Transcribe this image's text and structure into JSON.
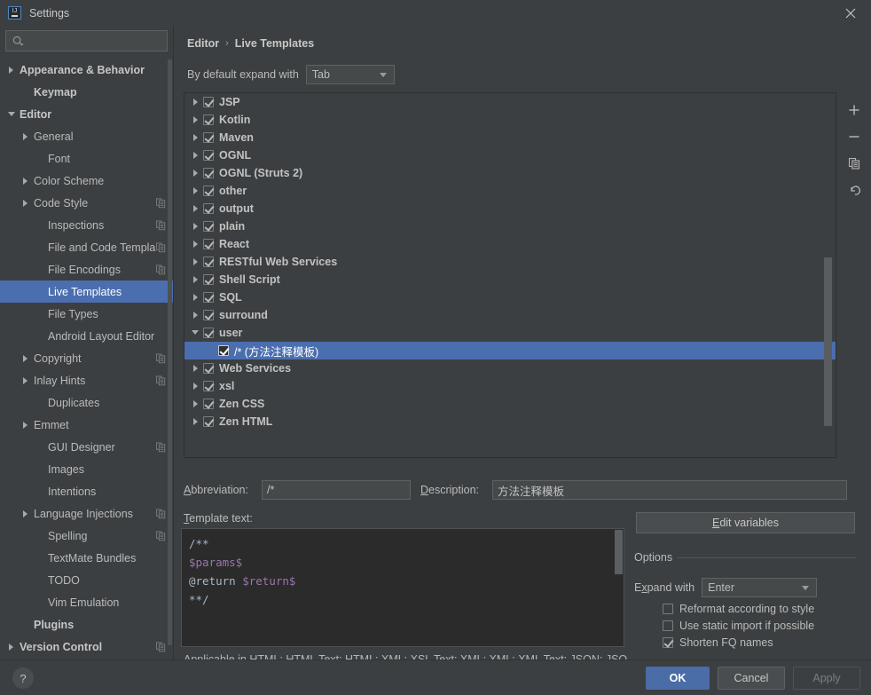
{
  "window": {
    "title": "Settings",
    "app_icon": "intellij-idea-icon",
    "close_icon": "close-icon"
  },
  "sidebar": {
    "search": {
      "placeholder": "",
      "value": "",
      "icon": "search-icon"
    },
    "items": [
      {
        "label": "Appearance & Behavior",
        "arrow": "closed",
        "bold": true,
        "indent": 0,
        "copyable": false,
        "selected": false
      },
      {
        "label": "Keymap",
        "arrow": "none",
        "bold": true,
        "indent": 1,
        "copyable": false,
        "selected": false
      },
      {
        "label": "Editor",
        "arrow": "open",
        "bold": true,
        "indent": 0,
        "copyable": false,
        "selected": false
      },
      {
        "label": "General",
        "arrow": "closed",
        "bold": false,
        "indent": 1,
        "copyable": false,
        "selected": false
      },
      {
        "label": "Font",
        "arrow": "none",
        "bold": false,
        "indent": 2,
        "copyable": false,
        "selected": false
      },
      {
        "label": "Color Scheme",
        "arrow": "closed",
        "bold": false,
        "indent": 1,
        "copyable": false,
        "selected": false
      },
      {
        "label": "Code Style",
        "arrow": "closed",
        "bold": false,
        "indent": 1,
        "copyable": true,
        "selected": false
      },
      {
        "label": "Inspections",
        "arrow": "none",
        "bold": false,
        "indent": 2,
        "copyable": true,
        "selected": false
      },
      {
        "label": "File and Code Templa",
        "arrow": "none",
        "bold": false,
        "indent": 2,
        "copyable": true,
        "selected": false
      },
      {
        "label": "File Encodings",
        "arrow": "none",
        "bold": false,
        "indent": 2,
        "copyable": true,
        "selected": false
      },
      {
        "label": "Live Templates",
        "arrow": "none",
        "bold": false,
        "indent": 2,
        "copyable": false,
        "selected": true
      },
      {
        "label": "File Types",
        "arrow": "none",
        "bold": false,
        "indent": 2,
        "copyable": false,
        "selected": false
      },
      {
        "label": "Android Layout Editor",
        "arrow": "none",
        "bold": false,
        "indent": 2,
        "copyable": false,
        "selected": false
      },
      {
        "label": "Copyright",
        "arrow": "closed",
        "bold": false,
        "indent": 1,
        "copyable": true,
        "selected": false
      },
      {
        "label": "Inlay Hints",
        "arrow": "closed",
        "bold": false,
        "indent": 1,
        "copyable": true,
        "selected": false
      },
      {
        "label": "Duplicates",
        "arrow": "none",
        "bold": false,
        "indent": 2,
        "copyable": false,
        "selected": false
      },
      {
        "label": "Emmet",
        "arrow": "closed",
        "bold": false,
        "indent": 1,
        "copyable": false,
        "selected": false
      },
      {
        "label": "GUI Designer",
        "arrow": "none",
        "bold": false,
        "indent": 2,
        "copyable": true,
        "selected": false
      },
      {
        "label": "Images",
        "arrow": "none",
        "bold": false,
        "indent": 2,
        "copyable": false,
        "selected": false
      },
      {
        "label": "Intentions",
        "arrow": "none",
        "bold": false,
        "indent": 2,
        "copyable": false,
        "selected": false
      },
      {
        "label": "Language Injections",
        "arrow": "closed",
        "bold": false,
        "indent": 1,
        "copyable": true,
        "selected": false
      },
      {
        "label": "Spelling",
        "arrow": "none",
        "bold": false,
        "indent": 2,
        "copyable": true,
        "selected": false
      },
      {
        "label": "TextMate Bundles",
        "arrow": "none",
        "bold": false,
        "indent": 2,
        "copyable": false,
        "selected": false
      },
      {
        "label": "TODO",
        "arrow": "none",
        "bold": false,
        "indent": 2,
        "copyable": false,
        "selected": false
      },
      {
        "label": "Vim Emulation",
        "arrow": "none",
        "bold": false,
        "indent": 2,
        "copyable": false,
        "selected": false
      },
      {
        "label": "Plugins",
        "arrow": "none",
        "bold": true,
        "indent": 1,
        "copyable": false,
        "selected": false
      },
      {
        "label": "Version Control",
        "arrow": "closed",
        "bold": true,
        "indent": 0,
        "copyable": true,
        "selected": false
      }
    ]
  },
  "main": {
    "breadcrumb": {
      "parent": "Editor",
      "separator": "›",
      "current": "Live Templates"
    },
    "expand_row": {
      "label": "By default expand with",
      "value": "Tab"
    },
    "tree": [
      {
        "label": "JSP",
        "state": "closed",
        "checked": true,
        "child": false
      },
      {
        "label": "Kotlin",
        "state": "closed",
        "checked": true,
        "child": false
      },
      {
        "label": "Maven",
        "state": "closed",
        "checked": true,
        "child": false
      },
      {
        "label": "OGNL",
        "state": "closed",
        "checked": true,
        "child": false
      },
      {
        "label": "OGNL (Struts 2)",
        "state": "closed",
        "checked": true,
        "child": false
      },
      {
        "label": "other",
        "state": "closed",
        "checked": true,
        "child": false
      },
      {
        "label": "output",
        "state": "closed",
        "checked": true,
        "child": false
      },
      {
        "label": "plain",
        "state": "closed",
        "checked": true,
        "child": false
      },
      {
        "label": "React",
        "state": "closed",
        "checked": true,
        "child": false
      },
      {
        "label": "RESTful Web Services",
        "state": "closed",
        "checked": true,
        "child": false
      },
      {
        "label": "Shell Script",
        "state": "closed",
        "checked": true,
        "child": false
      },
      {
        "label": "SQL",
        "state": "closed",
        "checked": true,
        "child": false
      },
      {
        "label": "surround",
        "state": "closed",
        "checked": true,
        "child": false
      },
      {
        "label": "user",
        "state": "open",
        "checked": true,
        "child": false
      },
      {
        "label": "/* (方法注释模板)",
        "state": "none",
        "checked": true,
        "child": true,
        "selected": true
      },
      {
        "label": "Web Services",
        "state": "closed",
        "checked": true,
        "child": false
      },
      {
        "label": "xsl",
        "state": "closed",
        "checked": true,
        "child": false
      },
      {
        "label": "Zen CSS",
        "state": "closed",
        "checked": true,
        "child": false
      },
      {
        "label": "Zen HTML",
        "state": "closed",
        "checked": true,
        "child": false
      }
    ],
    "toolbar": [
      {
        "name": "add-template-button",
        "icon": "plus-icon"
      },
      {
        "name": "remove-template-button",
        "icon": "minus-icon"
      },
      {
        "name": "duplicate-template-button",
        "icon": "copy-icon"
      },
      {
        "name": "revert-template-button",
        "icon": "undo-icon"
      }
    ],
    "form": {
      "abbreviation_label": "Abbreviation:",
      "abbreviation_value": "/*",
      "description_label": "Description:",
      "description_value": "方法注释模板",
      "template_text_label": "Template text:",
      "template_text_lines": [
        {
          "text": "/**",
          "kind": "plain"
        },
        {
          "text": "$params$",
          "kind": "var"
        },
        {
          "text": "@return $return$",
          "kind": "mixed",
          "prefix": "@return ",
          "var": "$return$"
        },
        {
          "text": "**/",
          "kind": "plain"
        }
      ],
      "applicable_text": "Applicable in HTML: HTML Text; HTML; XML: XSL Text; XML; XML: XML Text; JSON; JSO"
    },
    "options": {
      "edit_variables_button": "Edit variables",
      "group_title": "Options",
      "expand_with_label": "Expand with",
      "expand_with_value": "Enter",
      "checkboxes": [
        {
          "label": "Reformat according to style",
          "checked": false
        },
        {
          "label": "Use static import if possible",
          "checked": false
        },
        {
          "label": "Shorten FQ names",
          "checked": true
        }
      ]
    }
  },
  "footer": {
    "help_label": "?",
    "ok_label": "OK",
    "cancel_label": "Cancel",
    "apply_label": "Apply"
  },
  "colors": {
    "background": "#3c3f41",
    "selection": "#4b6eaf",
    "accent_button": "#4a6da7",
    "editor_background": "#2b2b2b",
    "variable_text": "#9876aa",
    "code_text": "#a9b7c6"
  }
}
